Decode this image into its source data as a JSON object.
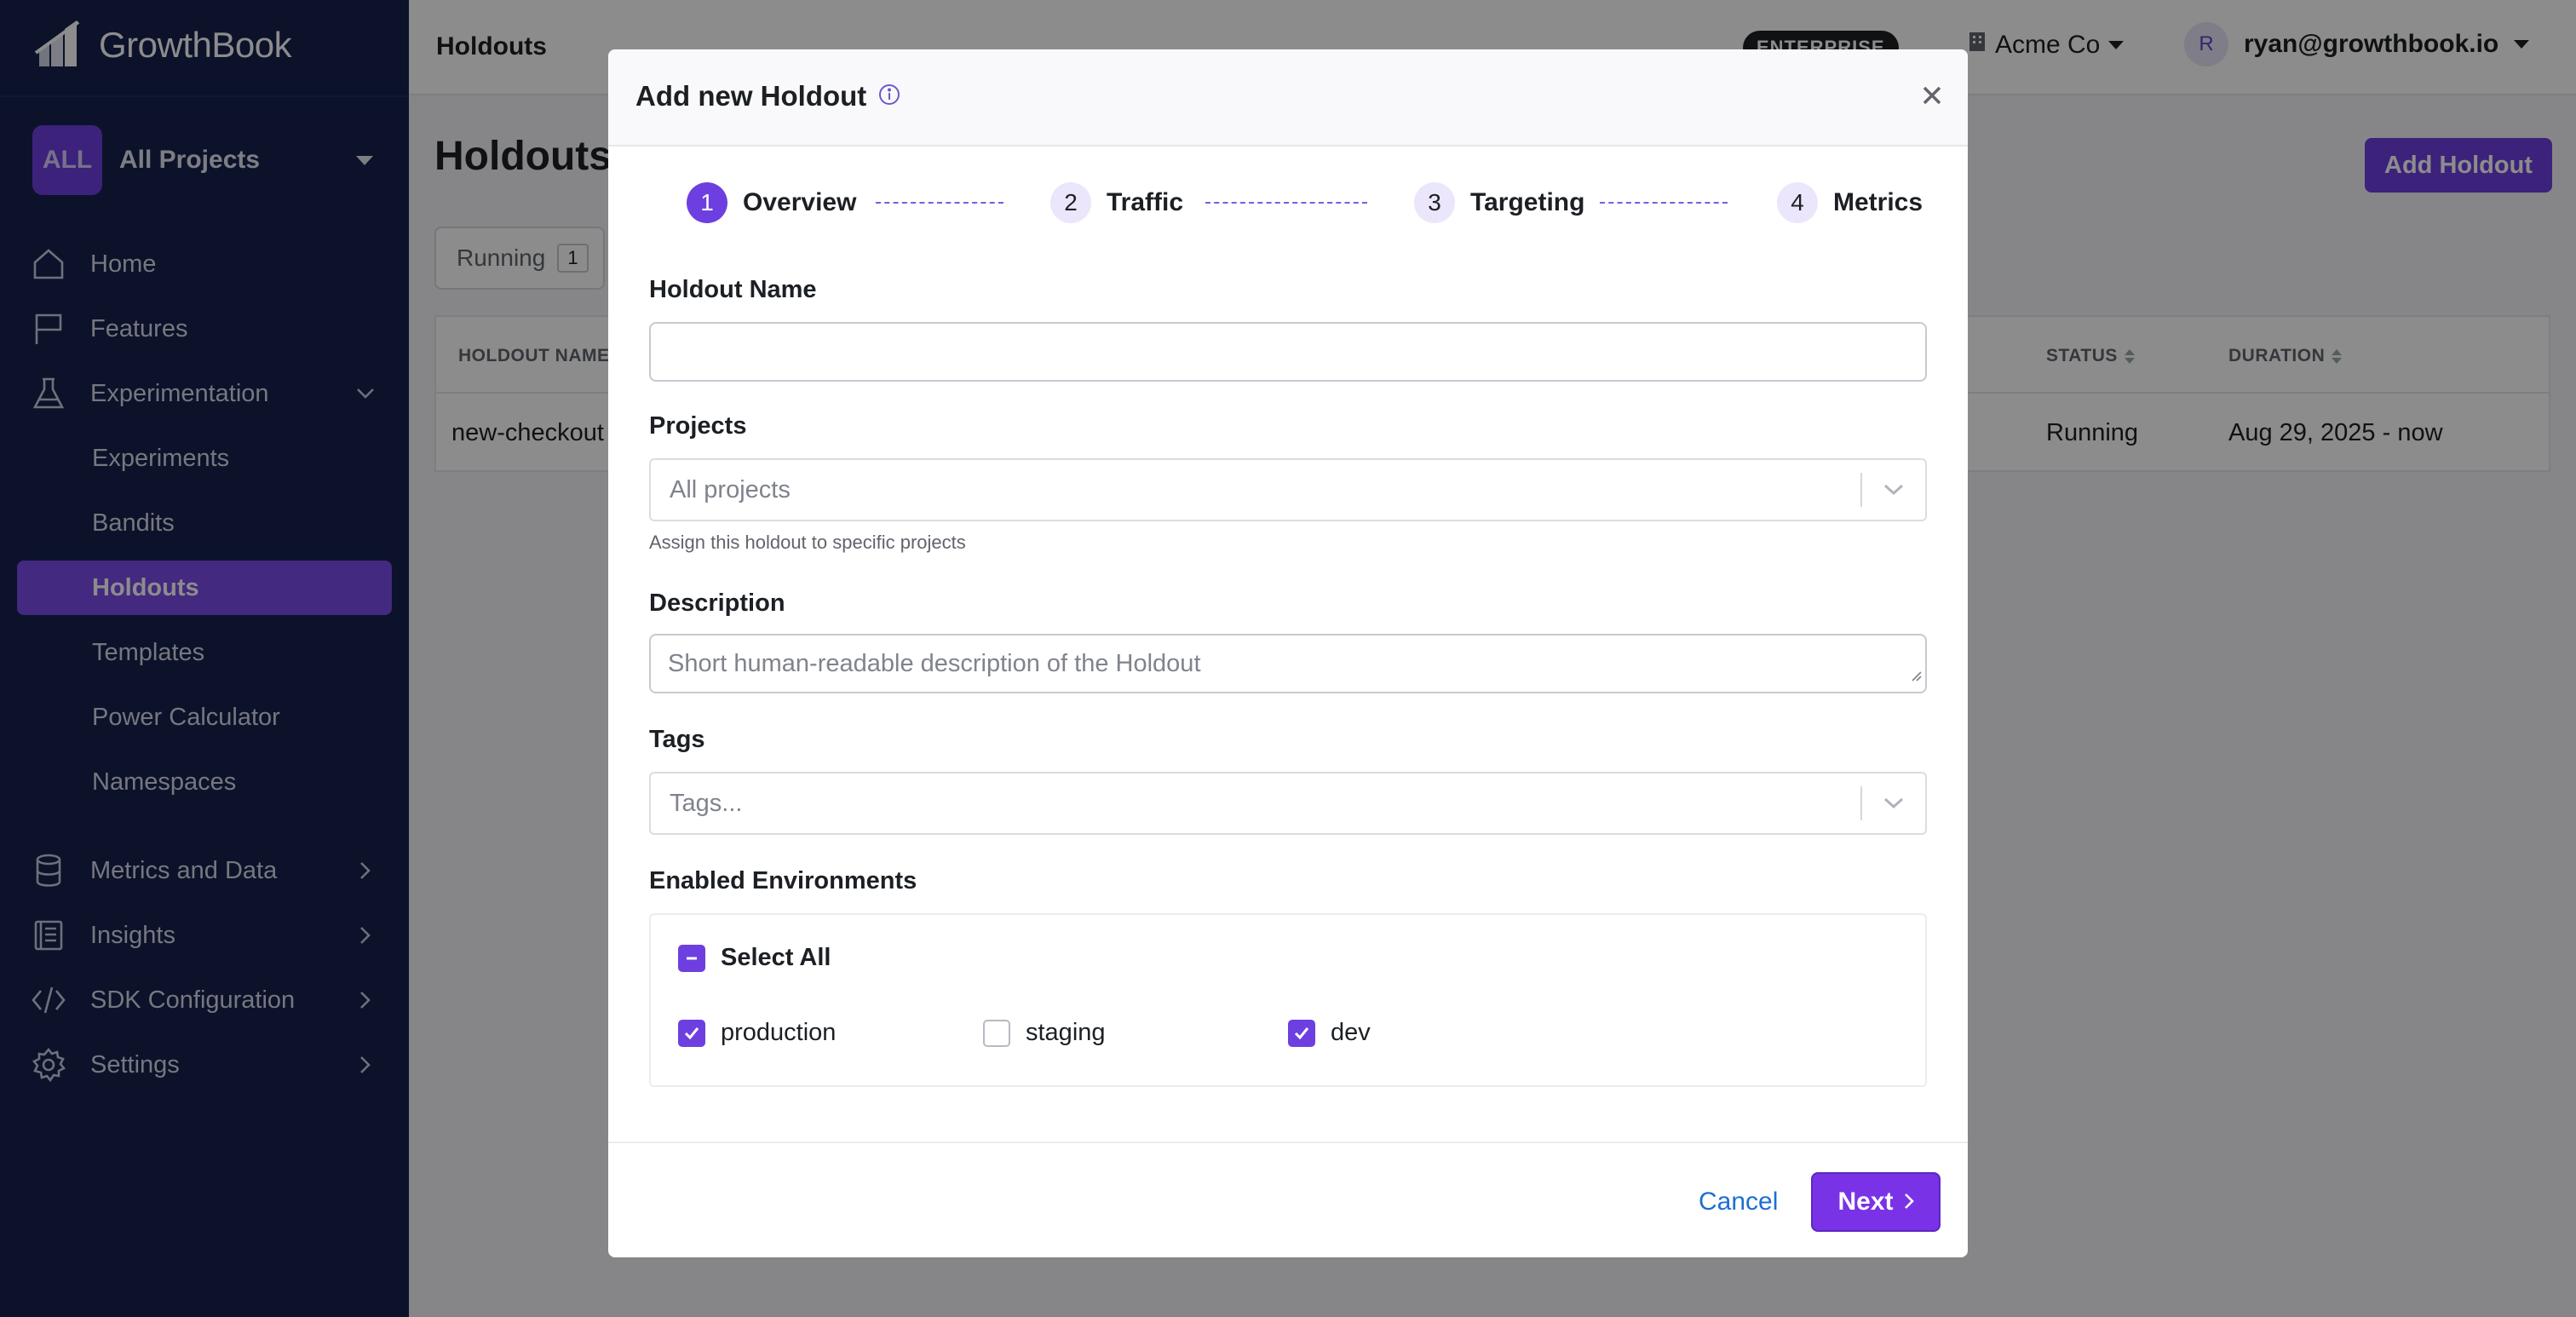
{
  "sidebar": {
    "brand": "GrowthBook",
    "project": {
      "badge": "ALL",
      "name": "All Projects"
    },
    "nav": [
      {
        "label": "Home",
        "icon": "home-icon"
      },
      {
        "label": "Features",
        "icon": "flag-icon"
      },
      {
        "label": "Experimentation",
        "icon": "flask-icon",
        "expanded": true
      }
    ],
    "sub": [
      {
        "label": "Experiments"
      },
      {
        "label": "Bandits"
      },
      {
        "label": "Holdouts",
        "active": true
      },
      {
        "label": "Templates"
      },
      {
        "label": "Power Calculator"
      },
      {
        "label": "Namespaces"
      }
    ],
    "nav2": [
      {
        "label": "Metrics and Data",
        "icon": "database-icon"
      },
      {
        "label": "Insights",
        "icon": "report-icon"
      },
      {
        "label": "SDK Configuration",
        "icon": "code-icon"
      },
      {
        "label": "Settings",
        "icon": "gear-icon"
      }
    ]
  },
  "topbar": {
    "page_title": "Holdouts",
    "plan_badge": "ENTERPRISE",
    "org": "Acme Co",
    "avatar_letter": "R",
    "user_email": "ryan@growthbook.io"
  },
  "page": {
    "heading": "Holdouts",
    "add_button": "Add Holdout",
    "tab_running": "Running",
    "tab_running_count": "1",
    "table": {
      "headers": {
        "name": "HOLDOUT NAME",
        "status": "STATUS",
        "duration": "DURATION"
      },
      "rows": [
        {
          "name": "new-checkout",
          "status": "Running",
          "duration": "Aug 29, 2025 - now"
        }
      ]
    }
  },
  "modal": {
    "title": "Add new Holdout",
    "steps": [
      {
        "num": "1",
        "label": "Overview",
        "active": true
      },
      {
        "num": "2",
        "label": "Traffic"
      },
      {
        "num": "3",
        "label": "Targeting"
      },
      {
        "num": "4",
        "label": "Metrics"
      }
    ],
    "fields": {
      "name_label": "Holdout Name",
      "name_value": "",
      "projects_label": "Projects",
      "projects_placeholder": "All projects",
      "projects_help": "Assign this holdout to specific projects",
      "description_label": "Description",
      "description_placeholder": "Short human-readable description of the Holdout",
      "tags_label": "Tags",
      "tags_placeholder": "Tags...",
      "env_label": "Enabled Environments",
      "select_all": "Select All",
      "environments": [
        {
          "label": "production",
          "checked": true
        },
        {
          "label": "staging",
          "checked": false
        },
        {
          "label": "dev",
          "checked": true
        }
      ]
    },
    "footer": {
      "cancel": "Cancel",
      "next": "Next"
    }
  }
}
